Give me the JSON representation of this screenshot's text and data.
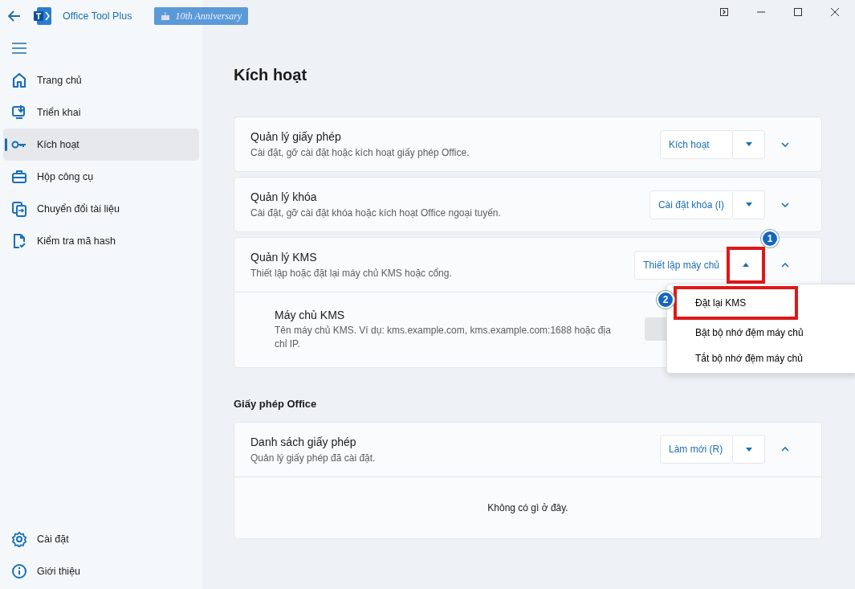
{
  "title_bar": {
    "app_name": "Office Tool Plus",
    "badge": "10th Anniversary"
  },
  "sidebar": {
    "items": [
      {
        "label": "Trang chủ",
        "kind": "home",
        "selected": false
      },
      {
        "label": "Triển khai",
        "kind": "deploy",
        "selected": false
      },
      {
        "label": "Kích hoạt",
        "kind": "key",
        "selected": true
      },
      {
        "label": "Hộp công cụ",
        "kind": "toolbox",
        "selected": false
      },
      {
        "label": "Chuyển đổi tài liệu",
        "kind": "convert",
        "selected": false
      },
      {
        "label": "Kiểm tra mã hash",
        "kind": "hash",
        "selected": false
      }
    ],
    "footer_items": [
      {
        "label": "Cài đặt",
        "kind": "gear",
        "selected": false
      },
      {
        "label": "Giới thiệu",
        "kind": "info",
        "selected": false
      }
    ]
  },
  "page_title": "Kích hoạt",
  "cards": [
    {
      "title": "Quản lý giấy phép",
      "description": "Cài đặt, gỡ cài đặt hoặc kích hoạt giấy phép Office.",
      "action": "Kích hoạt",
      "expanded": false
    },
    {
      "title": "Quản lý khóa",
      "description": "Cài đặt, gỡ cài đặt khóa hoặc kích hoạt Office ngoại tuyến.",
      "action": "Cài đặt khóa (I)",
      "expanded": false
    },
    {
      "title": "Quản lý KMS",
      "description": "Thiết lập hoặc đặt lại máy chủ KMS hoặc cổng.",
      "action": "Thiết lập máy chủ",
      "expanded": true,
      "menu_open": true,
      "body": {
        "kind": "setting",
        "title": "Máy chủ KMS",
        "description": "Tên máy chủ KMS. Ví dụ: kms.example.com, kms.example.com:1688 hoặc địa chỉ IP."
      }
    }
  ],
  "section_title": "Giấy phép Office",
  "license_cards": [
    {
      "title": "Danh sách giấy phép",
      "description": "Quản lý giấy phép đã cài đặt.",
      "action": "Làm mới (R)",
      "expanded": true,
      "body": {
        "kind": "empty",
        "text": "Không có gì ở đây."
      }
    }
  ],
  "dropdown_menu": {
    "items": [
      "Đặt lại KMS",
      "Bật bộ nhớ đệm máy chủ",
      "Tắt bộ nhớ đệm máy chủ"
    ]
  },
  "annotations": [
    {
      "label": "1"
    },
    {
      "label": "2"
    }
  ]
}
